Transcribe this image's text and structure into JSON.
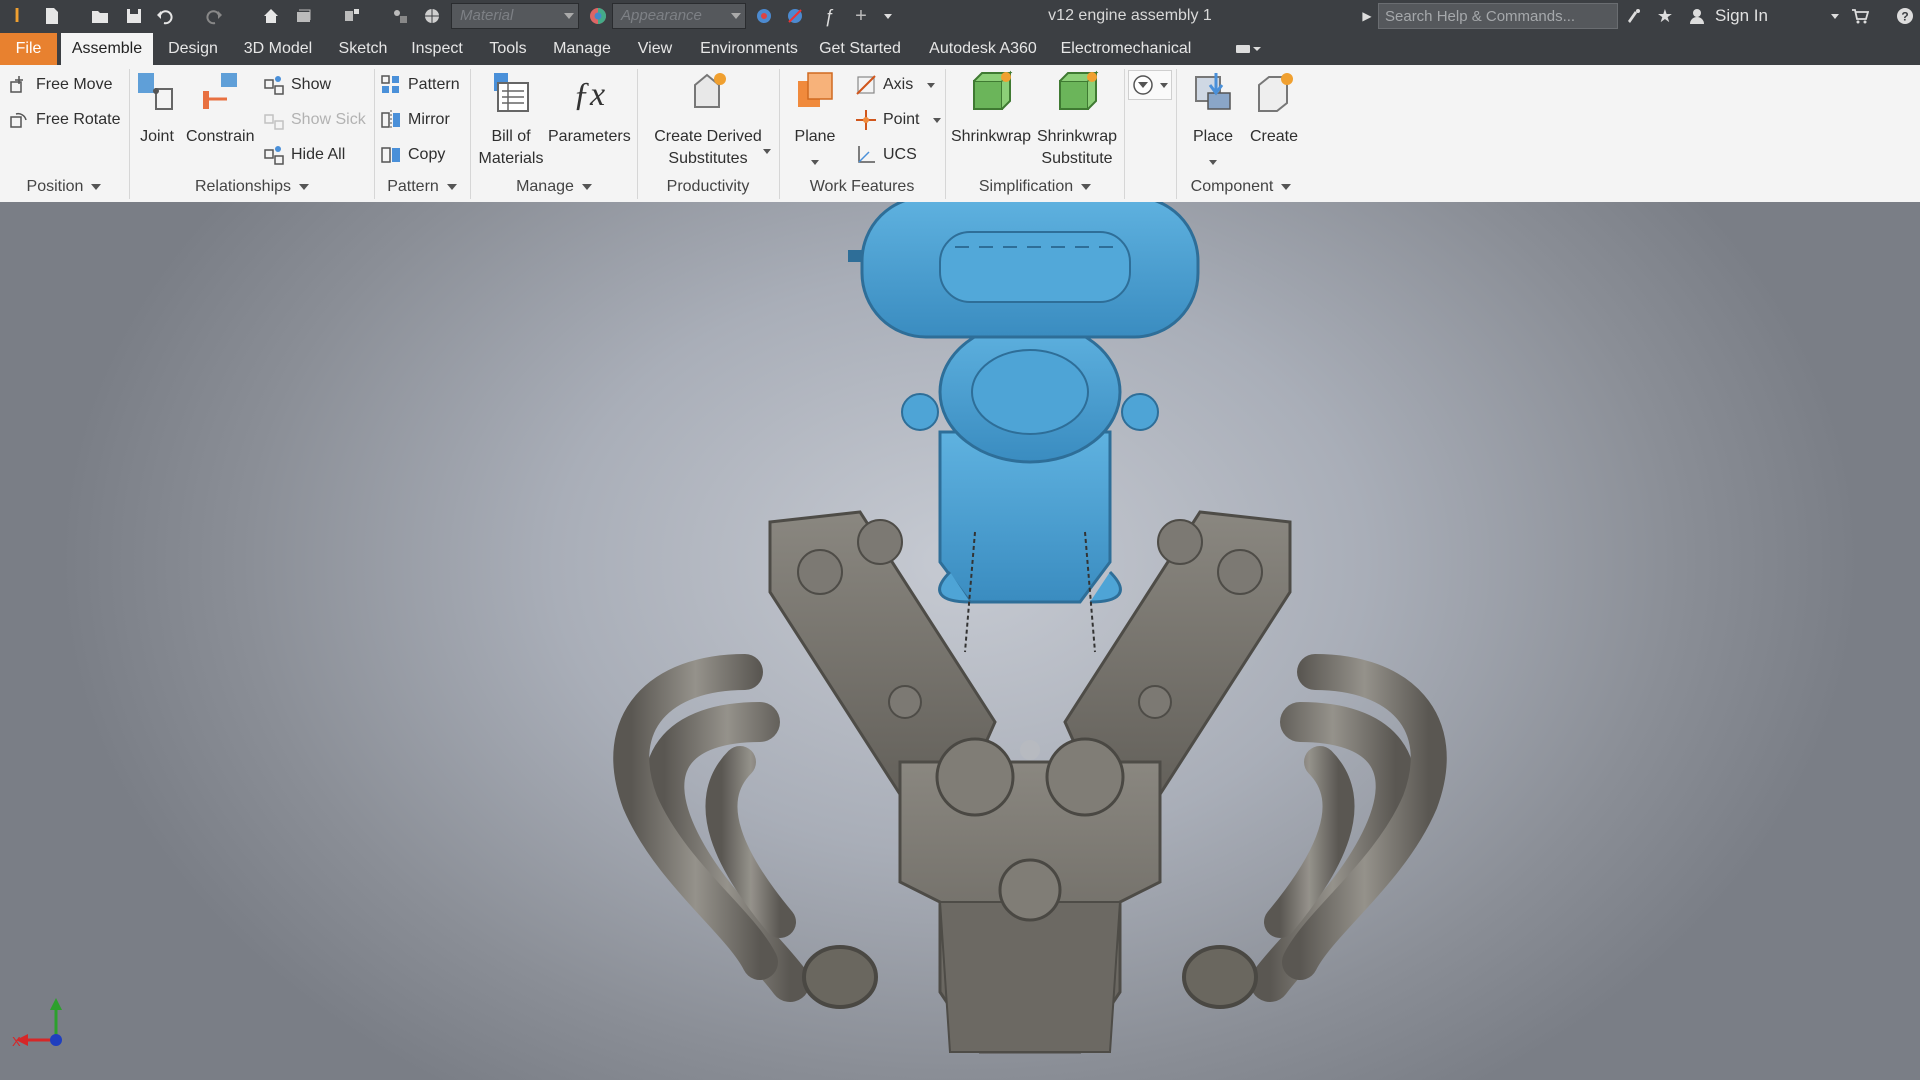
{
  "app": {
    "logo_text": "I",
    "document_title": "v12 engine assembly 1",
    "material_placeholder": "Material",
    "appearance_placeholder": "Appearance",
    "search_placeholder": "Search Help & Commands...",
    "sign_in": "Sign In"
  },
  "tabs": [
    {
      "label": "File"
    },
    {
      "label": "Assemble"
    },
    {
      "label": "Design"
    },
    {
      "label": "3D Model"
    },
    {
      "label": "Sketch"
    },
    {
      "label": "Inspect"
    },
    {
      "label": "Tools"
    },
    {
      "label": "Manage"
    },
    {
      "label": "View"
    },
    {
      "label": "Environments"
    },
    {
      "label": "Get Started"
    },
    {
      "label": "Autodesk A360"
    },
    {
      "label": "Electromechanical"
    }
  ],
  "ribbon": {
    "position": {
      "free_move": "Free Move",
      "free_rotate": "Free Rotate",
      "group": "Position"
    },
    "relationships": {
      "joint": "Joint",
      "constrain": "Constrain",
      "show": "Show",
      "show_sick": "Show Sick",
      "hide_all": "Hide All",
      "group": "Relationships"
    },
    "pattern": {
      "pattern": "Pattern",
      "mirror": "Mirror",
      "copy": "Copy",
      "group": "Pattern"
    },
    "manage": {
      "bom_line1": "Bill of",
      "bom_line2": "Materials",
      "parameters": "Parameters",
      "group": "Manage"
    },
    "productivity": {
      "line1": "Create Derived",
      "line2": "Substitutes",
      "group": "Productivity"
    },
    "work_features": {
      "plane": "Plane",
      "axis": "Axis",
      "point": "Point",
      "ucs": "UCS",
      "group": "Work Features"
    },
    "simplification": {
      "shrinkwrap": "Shrinkwrap",
      "sub_line1": "Shrinkwrap",
      "sub_line2": "Substitute",
      "group": "Simplification"
    },
    "component": {
      "place": "Place",
      "create": "Create",
      "group": "Component"
    }
  },
  "viewport": {
    "triad_x_label": "X",
    "colors": {
      "engine_block": "#77746f",
      "intake": "#4b9fd1",
      "background_center": "#c6cad2"
    }
  }
}
